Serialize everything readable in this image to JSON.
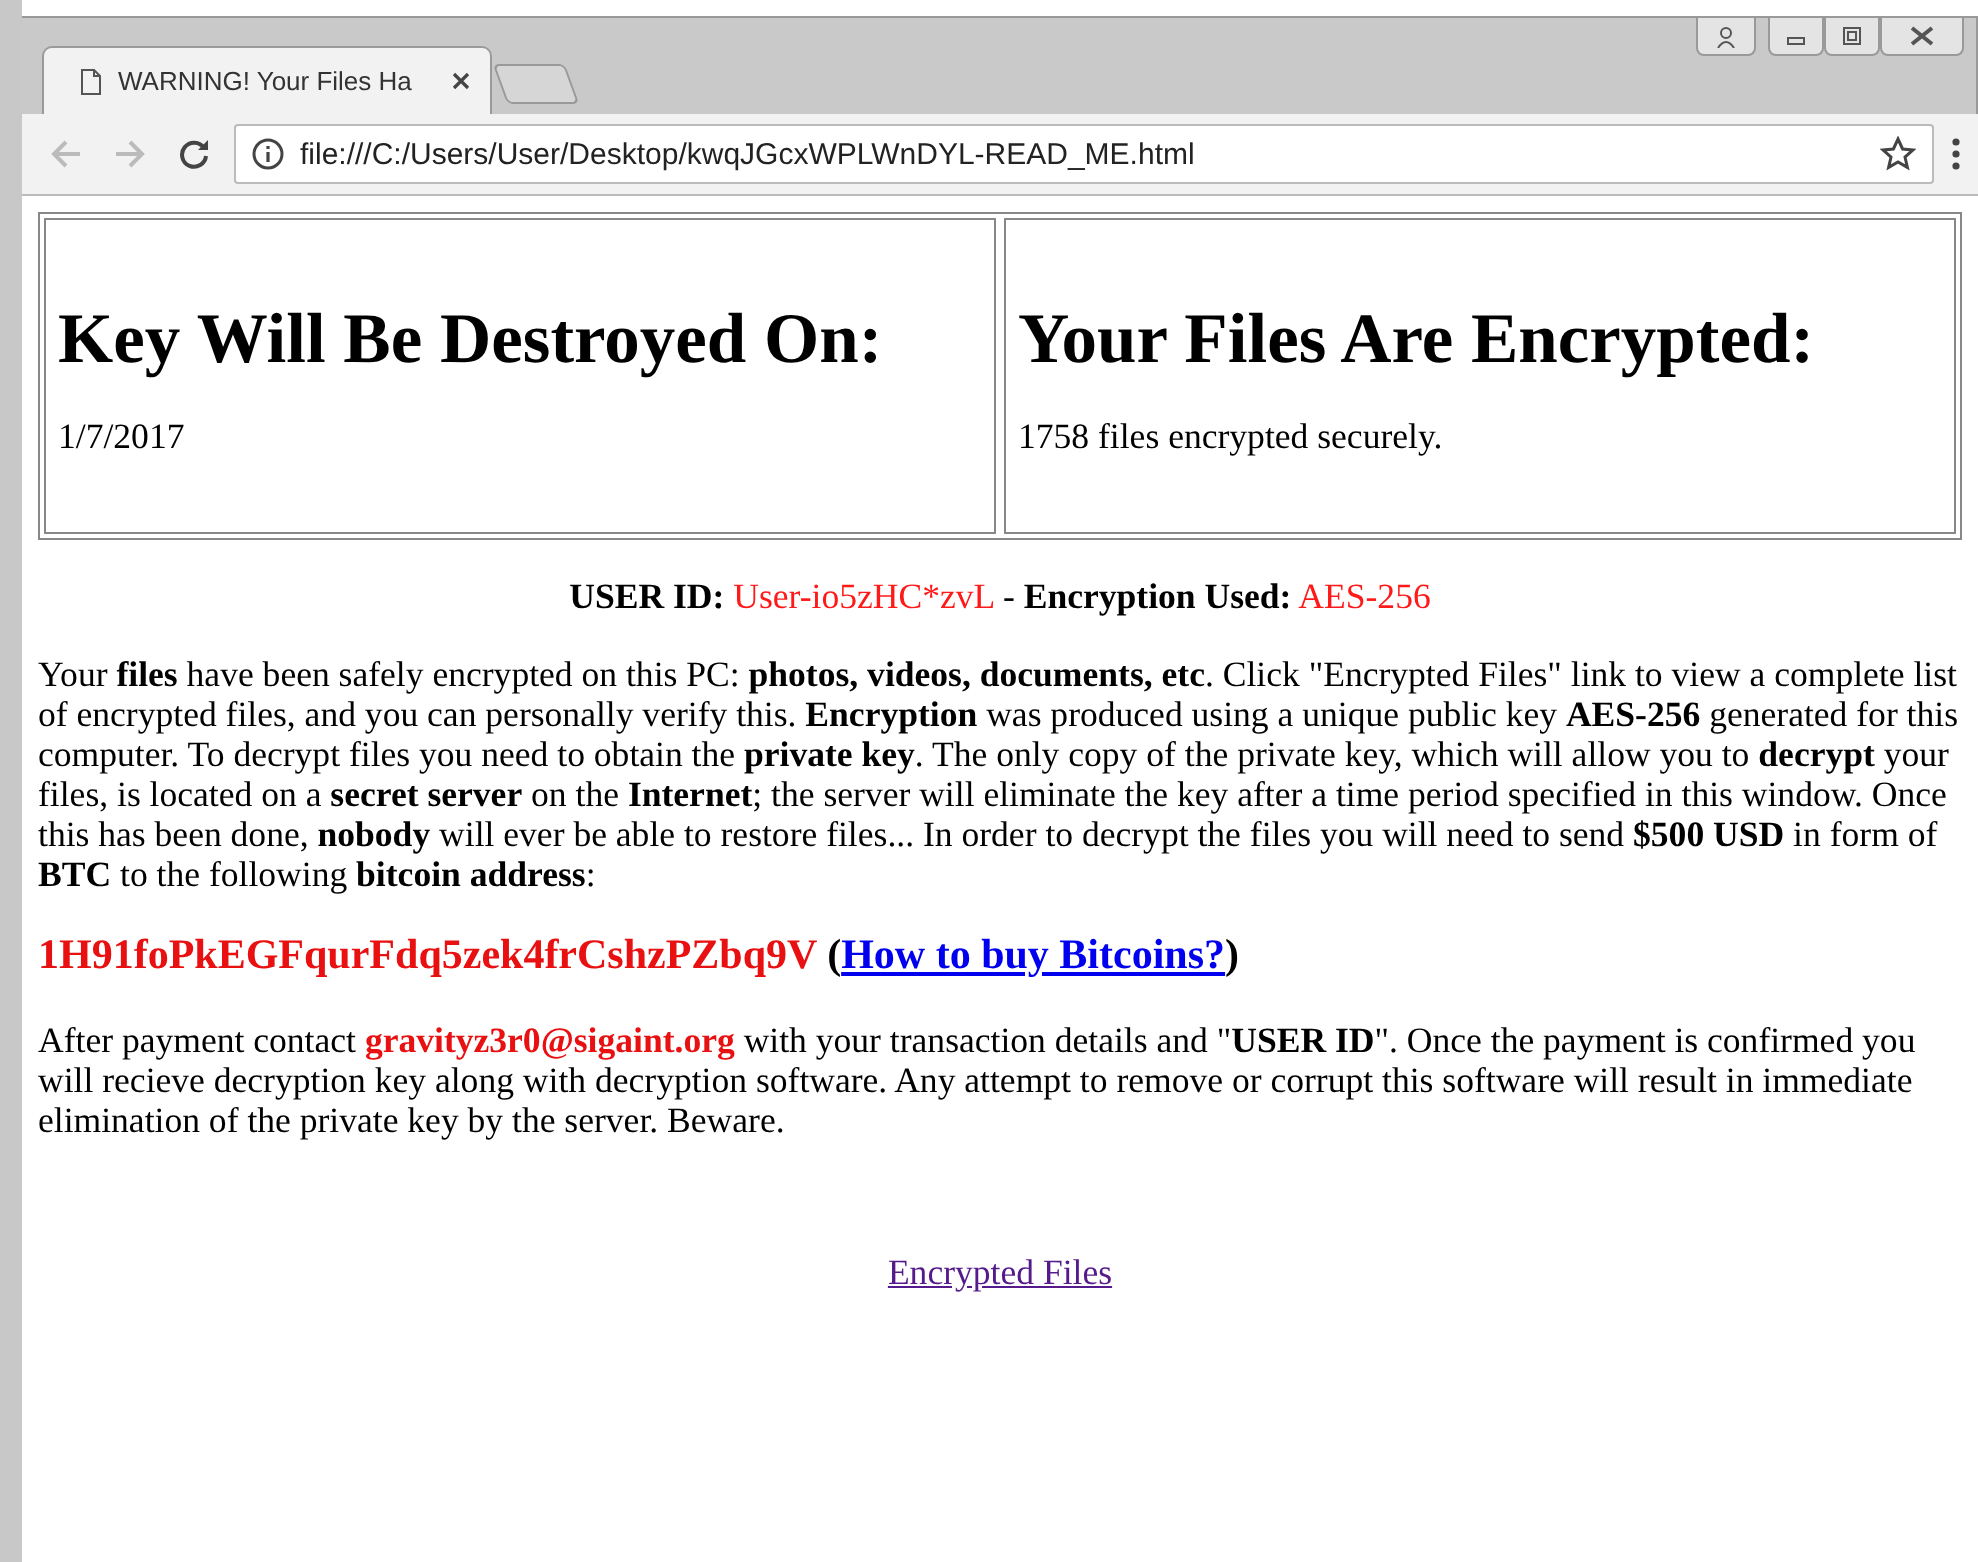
{
  "tab": {
    "title": "WARNING! Your Files Ha",
    "selected": true
  },
  "address_bar": {
    "url": "file:///C:/Users/User/Desktop/kwqJGcxWPLWnDYL-READ_ME.html"
  },
  "cards": [
    {
      "heading": "Key Will Be Destroyed On:",
      "text": "1/7/2017"
    },
    {
      "heading": "Your Files Are Encrypted:",
      "text": "1758 files encrypted securely."
    }
  ],
  "id_line": {
    "user_id_label": "USER ID:",
    "user_id": "User-io5zHC*zvL",
    "separator": "-",
    "encryption_label": "Encryption Used:",
    "encryption": "AES-256"
  },
  "intro": "Your **files** have been safely encrypted on this PC: **photos, videos, documents, etc**. Click \"Encrypted Files\" link to view a complete list of encrypted files, and you can personally verify this. **Encryption** was produced using a unique public key **AES-256** generated for this computer. To decrypt files you need to obtain the **private key**. The only copy of the private key, which will allow you to **decrypt** your files, is located on a **secret server** on the **Internet**; the server will eliminate the key after a time period specified in this window. Once this has been done, **nobody** will ever be able to restore files... In order to decrypt the files you will need to send **$500 USD** in form of **BTC** to the following **bitcoin address**:",
  "address_line": {
    "address": "1H91foPkEGFqurFdq5zek4frCshzPZbq9V",
    "open": "(",
    "link": "How to buy Bitcoins?",
    "close": ")"
  },
  "payment_note": {
    "before": "After payment contact",
    "email": "gravityz3r0@sigaint.org",
    "after": "with your transaction details and \"**USER ID**\". Once the payment is confirmed you will recieve decryption key along with decryption software. Any attempt to remove or corrupt this software will result in immediate elimination of the private key by the server. Beware."
  },
  "files_link": "Encrypted Files"
}
